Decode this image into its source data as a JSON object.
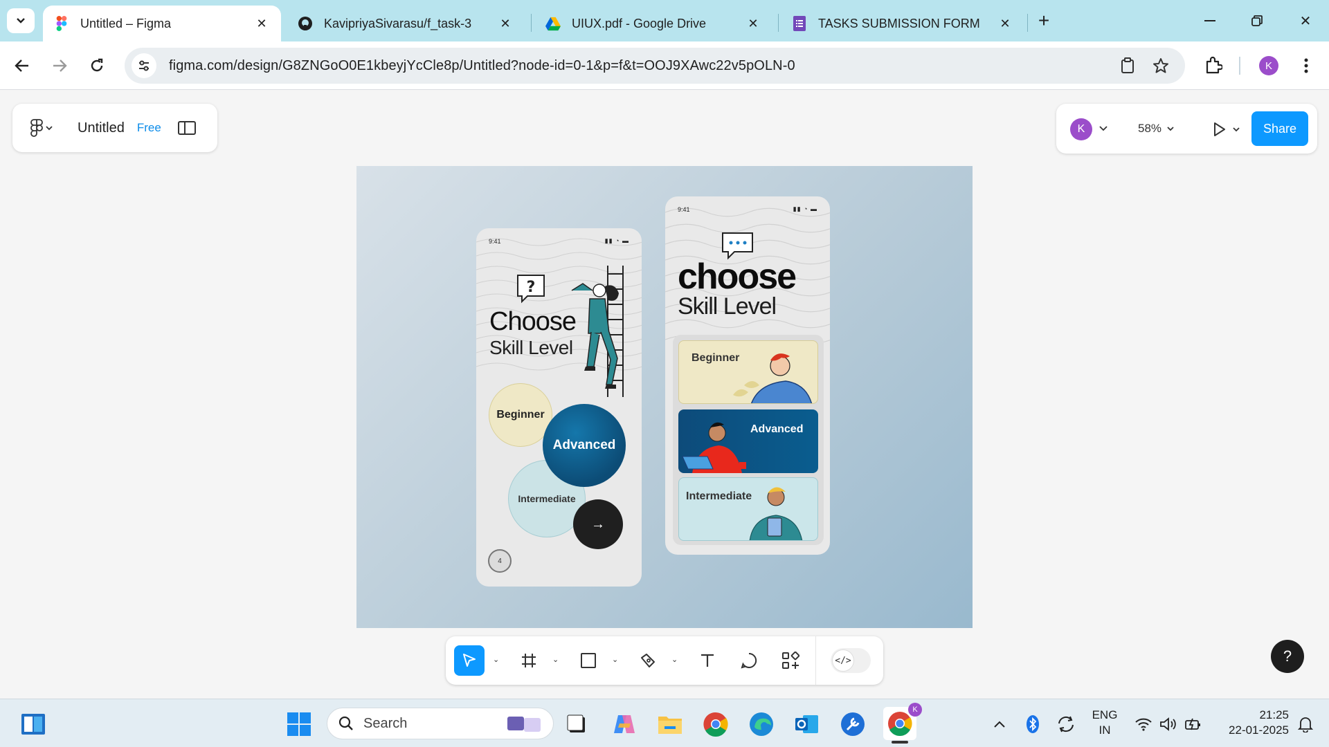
{
  "browser": {
    "tabs": [
      {
        "title": "Untitled – Figma",
        "icon": "figma-icon",
        "active": true
      },
      {
        "title": "KavipriyaSivarasu/f_task-3",
        "icon": "github-icon",
        "active": false
      },
      {
        "title": "UIUX.pdf - Google Drive",
        "icon": "google-drive-icon",
        "active": false
      },
      {
        "title": "TASKS SUBMISSION FORM",
        "icon": "google-forms-icon",
        "active": false
      }
    ],
    "url": "figma.com/design/G8ZNGoO0E1kbeyjYcCle8p/Untitled?node-id=0-1&p=f&t=OOJ9XAwc22v5pOLN-0",
    "profile_initial": "K"
  },
  "figma": {
    "file_name": "Untitled",
    "plan_badge": "Free",
    "user_initial": "K",
    "zoom": "58%",
    "share_label": "Share",
    "help_label": "?",
    "dev_mode_glyph": "</>",
    "phone1": {
      "time": "9:41",
      "title": "Choose",
      "subtitle": "Skill Level",
      "beginner": "Beginner",
      "advanced": "Advanced",
      "intermediate": "Intermediate",
      "next_arrow": "→",
      "step": "4"
    },
    "phone2": {
      "time": "9:41",
      "title": "choose",
      "subtitle": "Skill Level",
      "beginner": "Beginner",
      "advanced": "Advanced",
      "intermediate": "Intermediate"
    }
  },
  "taskbar": {
    "search_placeholder": "Search",
    "language": "ENG",
    "region": "IN",
    "time": "21:25",
    "date": "22-01-2025"
  },
  "colors": {
    "tab_strip": "#b8e4ee",
    "figma_blue": "#0d99ff",
    "avatar_purple": "#9b4dca",
    "advanced_blue": "#0c4c76",
    "beginner_yellow": "#efe8c6",
    "intermediate_teal": "#cbe3e6"
  }
}
